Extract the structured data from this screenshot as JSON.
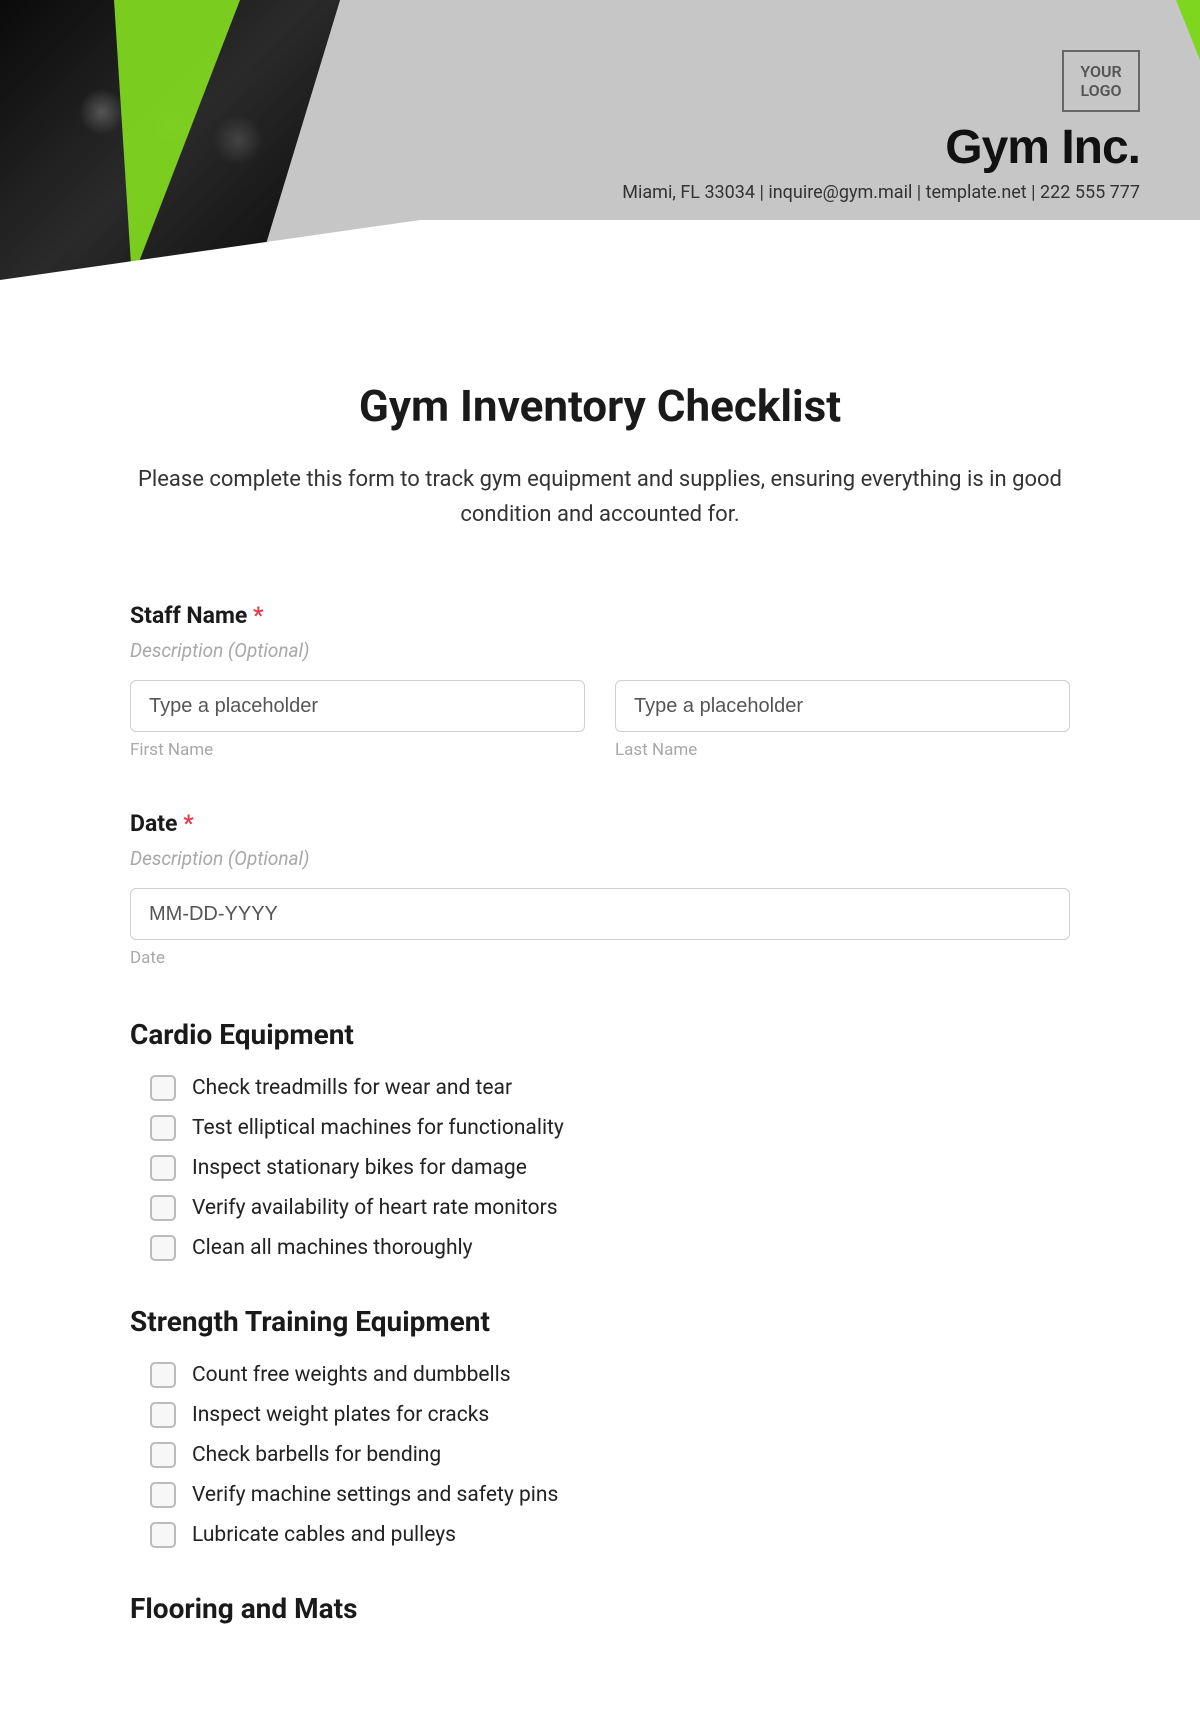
{
  "header": {
    "logo_text": "YOUR LOGO",
    "company": "Gym Inc.",
    "contact": "Miami, FL 33034 | inquire@gym.mail | template.net | 222 555 777"
  },
  "form": {
    "title": "Gym Inventory Checklist",
    "description": "Please complete this form to track gym equipment and supplies, ensuring everything is in good condition and accounted for."
  },
  "fields": {
    "staff_name": {
      "label": "Staff Name",
      "required": "*",
      "opt_desc": "Description (Optional)",
      "first": {
        "placeholder": "Type a placeholder",
        "sub": "First Name"
      },
      "last": {
        "placeholder": "Type a placeholder",
        "sub": "Last Name"
      }
    },
    "date": {
      "label": "Date",
      "required": "*",
      "opt_desc": "Description (Optional)",
      "placeholder": "MM-DD-YYYY",
      "sub": "Date"
    }
  },
  "sections": [
    {
      "title": "Cardio Equipment",
      "items": [
        "Check treadmills for wear and tear",
        "Test elliptical machines for functionality",
        "Inspect stationary bikes for damage",
        "Verify availability of heart rate monitors",
        "Clean all machines thoroughly"
      ]
    },
    {
      "title": "Strength Training Equipment",
      "items": [
        "Count free weights and dumbbells",
        "Inspect weight plates for cracks",
        "Check barbells for bending",
        "Verify machine settings and safety pins",
        "Lubricate cables and pulleys"
      ]
    },
    {
      "title": "Flooring and Mats",
      "items": []
    }
  ]
}
